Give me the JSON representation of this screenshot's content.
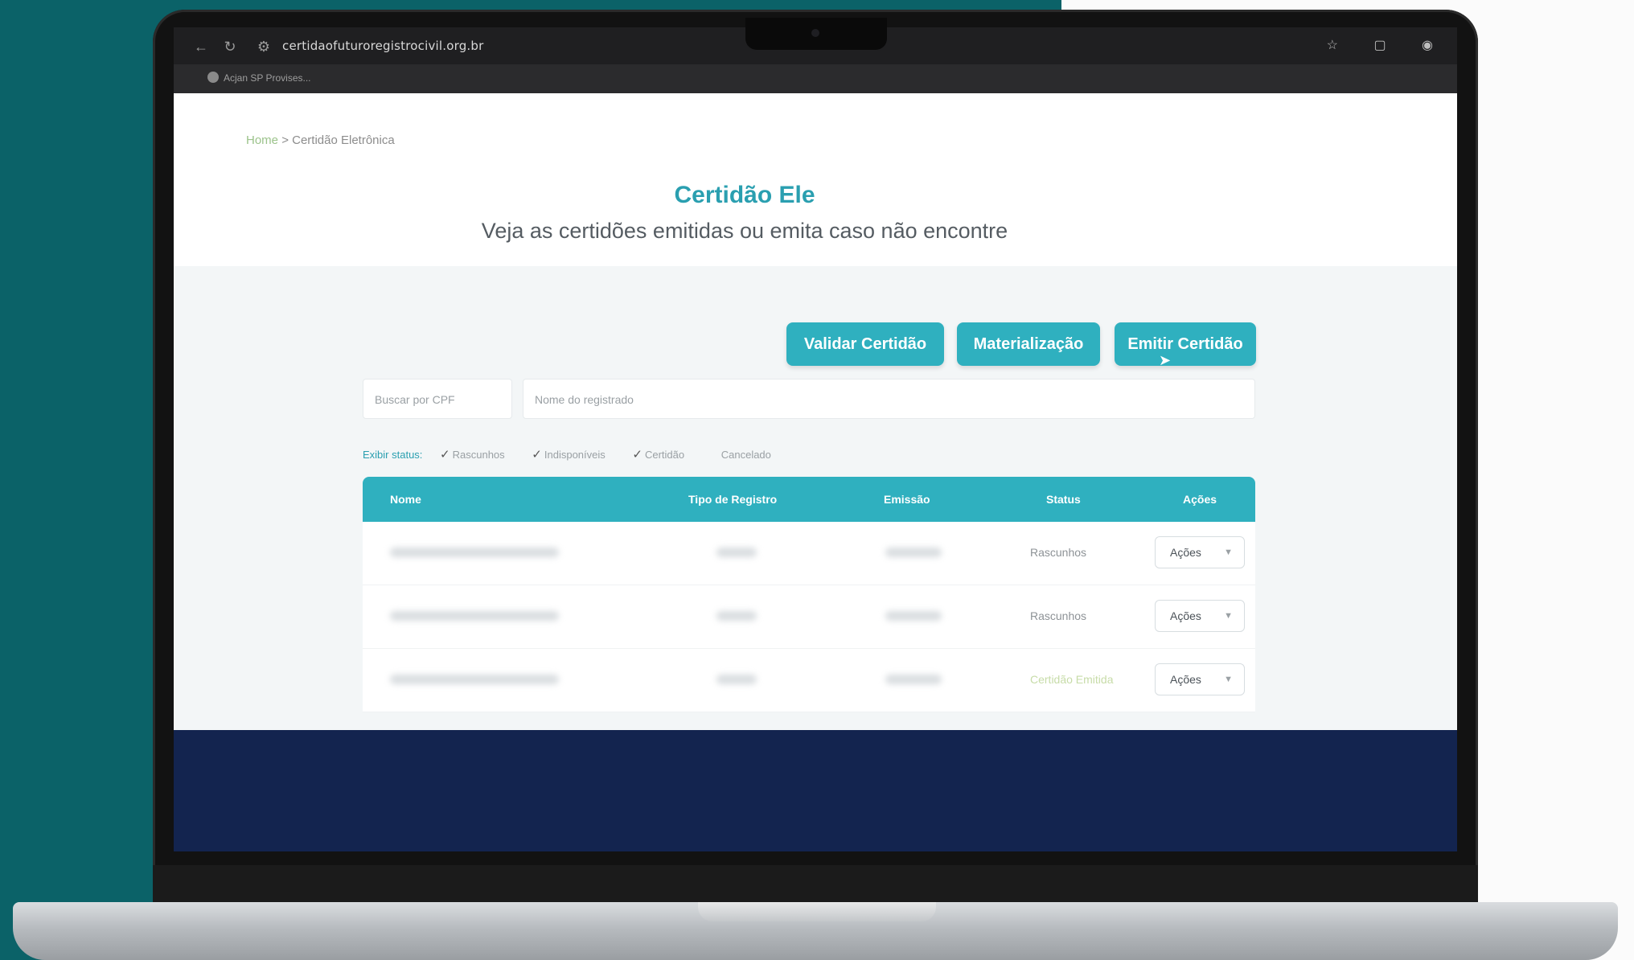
{
  "browser": {
    "url": "certidaofuturoregistrocivil.org.br",
    "bookmark": "Acjan SP Provises...",
    "nav_back": "←",
    "nav_reload": "↻",
    "nav_site": "⚙",
    "icon_star": "☆",
    "icon_extensions": "▢",
    "icon_profile": "◉"
  },
  "breadcrumb": {
    "home": "Home",
    "separator": ">",
    "current": "Certidão Eletrônica"
  },
  "header": {
    "title": "Certidão Ele",
    "subtitle": "Veja as certidões emitidas ou emita caso não encontre"
  },
  "actions": {
    "validar": "Validar Certidão",
    "materializacao": "Materialização",
    "emitir": "Emitir Certidão"
  },
  "search": {
    "cpf_placeholder": "Buscar por CPF",
    "name_placeholder": "Nome do registrado"
  },
  "filters": {
    "label": "Exibir status:",
    "items": [
      "Rascunhos",
      "Indisponíveis",
      "Certidão"
    ],
    "cancelled": "Cancelado"
  },
  "table": {
    "headers": [
      "Nome",
      "Tipo de Registro",
      "Emissão",
      "Status",
      "Ações"
    ],
    "rows": [
      {
        "status": "Rascunhos",
        "action": "Ações"
      },
      {
        "status": "Rascunhos",
        "action": "Ações"
      },
      {
        "status": "Certidão Emitida",
        "action": "Ações"
      }
    ]
  },
  "colors": {
    "accent": "#2fb0bf",
    "title": "#2a9fb0",
    "footer": "#13244f",
    "background_left": "#0b6268"
  }
}
